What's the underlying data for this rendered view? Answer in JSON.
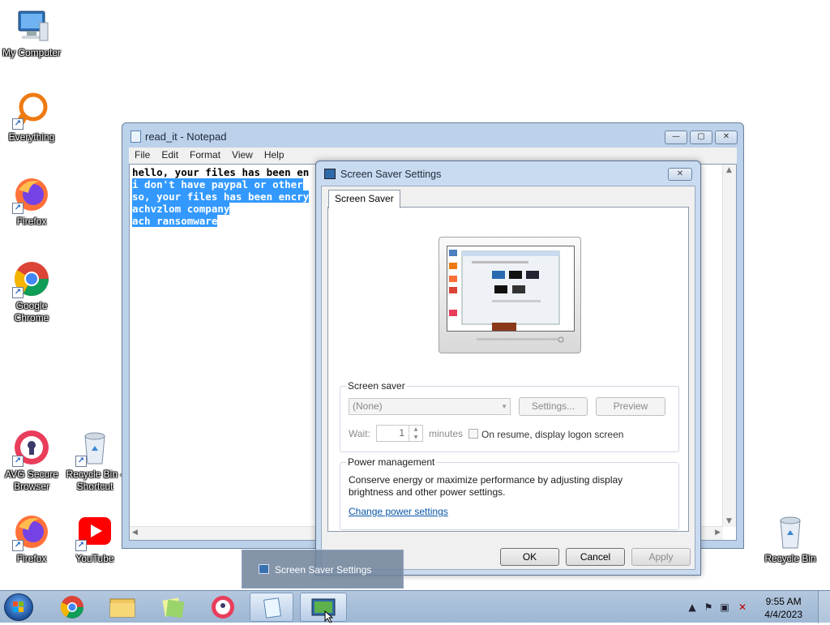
{
  "desktop": {
    "icons": [
      {
        "label": "My Computer",
        "name": "my-computer"
      },
      {
        "label": "Everything",
        "name": "everything"
      },
      {
        "label": "Firefox",
        "name": "firefox"
      },
      {
        "label": "Google Chrome",
        "name": "google-chrome"
      },
      {
        "label": "AVG Secure Browser",
        "name": "avg-secure-browser"
      },
      {
        "label": "Recycle Bin - Shortcut",
        "name": "recycle-bin-shortcut"
      },
      {
        "label": "Firefox",
        "name": "firefox-2"
      },
      {
        "label": "YouTube",
        "name": "youtube"
      },
      {
        "label": "Recycle Bin",
        "name": "recycle-bin"
      }
    ]
  },
  "notepad": {
    "title": "read_it - Notepad",
    "menu": [
      "File",
      "Edit",
      "Format",
      "View",
      "Help"
    ],
    "lines": [
      "hello, your files has been en",
      "i don't have paypal or other",
      "so, your files has been encry",
      "achvzlom company",
      "ach ransomware"
    ],
    "caption_buttons": {
      "minimize": "—",
      "maximize": "▢",
      "close": "✕"
    }
  },
  "dialog": {
    "title": "Screen Saver Settings",
    "close": "✕",
    "tab": "Screen Saver",
    "screen_saver_group": "Screen saver",
    "selected_saver": "(None)",
    "settings_button": "Settings...",
    "preview_button": "Preview",
    "wait_label": "Wait:",
    "wait_value": "1",
    "minutes_label": "minutes",
    "resume_label": "On resume, display logon screen",
    "power_group": "Power management",
    "power_text_1": "Conserve energy or maximize performance by adjusting display",
    "power_text_2": "brightness and other power settings.",
    "power_link": "Change power settings",
    "ok": "OK",
    "cancel": "Cancel",
    "apply": "Apply"
  },
  "taskbar": {
    "thumbnail_title": "Screen Saver Settings",
    "time": "9:55 AM",
    "date": "4/4/2023"
  }
}
